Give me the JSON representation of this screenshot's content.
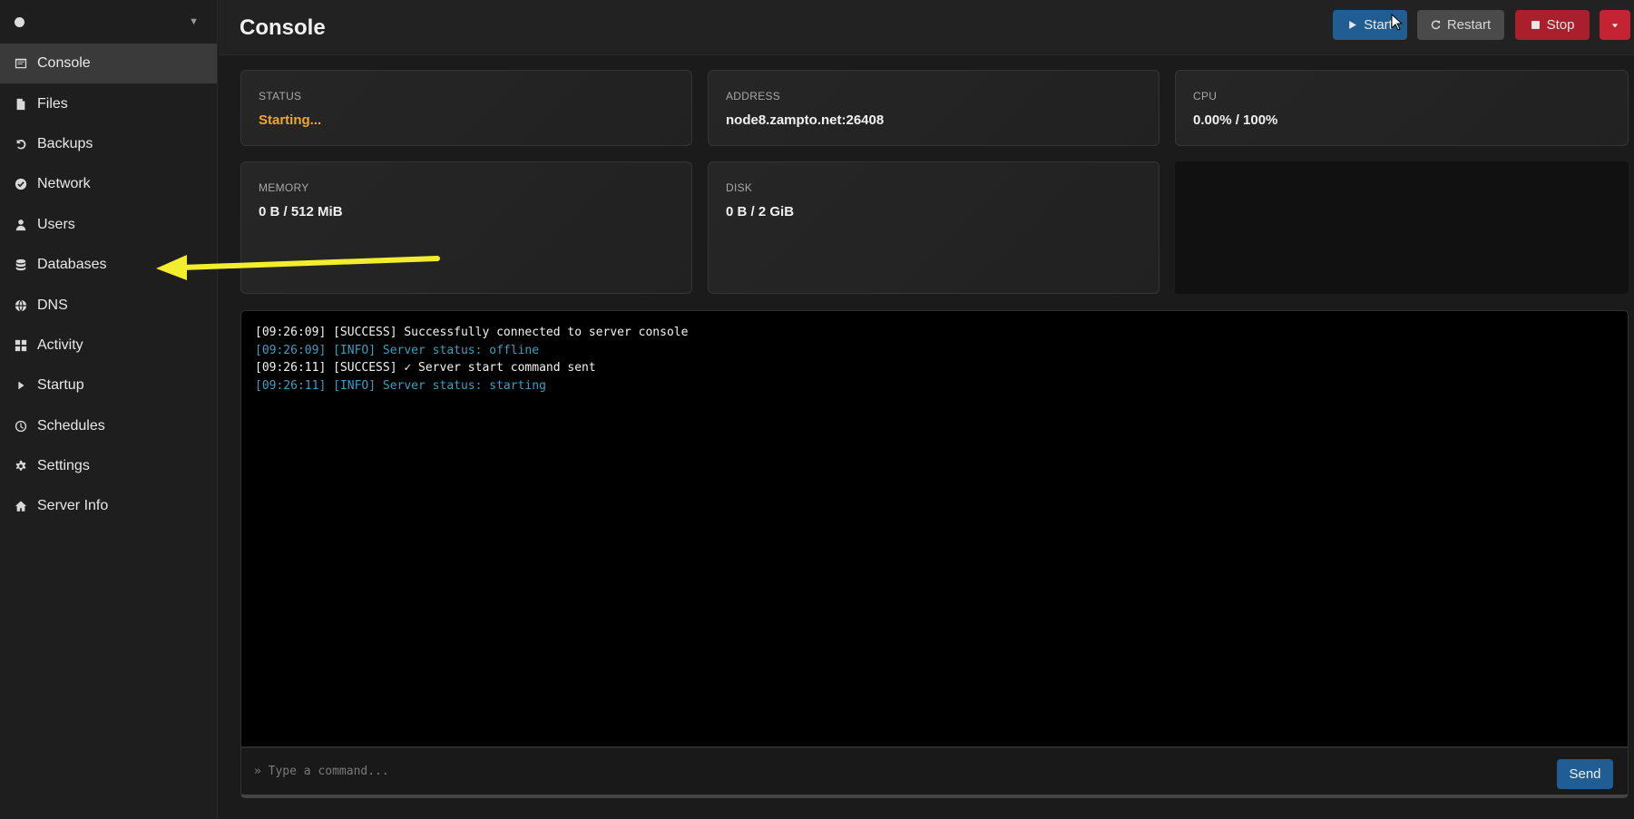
{
  "sidebar": {
    "items": [
      {
        "label": "Console",
        "icon": "console-icon"
      },
      {
        "label": "Files",
        "icon": "file-icon"
      },
      {
        "label": "Backups",
        "icon": "undo-icon"
      },
      {
        "label": "Network",
        "icon": "check-circle-icon"
      },
      {
        "label": "Users",
        "icon": "user-icon"
      },
      {
        "label": "Databases",
        "icon": "database-icon"
      },
      {
        "label": "DNS",
        "icon": "globe-icon"
      },
      {
        "label": "Activity",
        "icon": "grid-icon"
      },
      {
        "label": "Startup",
        "icon": "play-icon"
      },
      {
        "label": "Schedules",
        "icon": "clock-icon"
      },
      {
        "label": "Settings",
        "icon": "gear-icon"
      },
      {
        "label": "Server Info",
        "icon": "home-icon"
      }
    ]
  },
  "header": {
    "title": "Console",
    "start_label": "Start",
    "restart_label": "Restart",
    "stop_label": "Stop"
  },
  "stats": {
    "status": {
      "label": "STATUS",
      "value": "Starting..."
    },
    "address": {
      "label": "ADDRESS",
      "value": "node8.zampto.net:26408"
    },
    "cpu": {
      "label": "CPU",
      "value": "0.00% / 100%"
    },
    "memory": {
      "label": "MEMORY",
      "value": "0 B / 512 MiB"
    },
    "disk": {
      "label": "DISK",
      "value": "0 B / 2 GiB"
    }
  },
  "console": {
    "lines": [
      {
        "text": "[09:26:09] [SUCCESS] Successfully connected to server console",
        "level": "success"
      },
      {
        "text": "[09:26:09] [INFO] Server status: offline",
        "level": "info"
      },
      {
        "text": "[09:26:11] [SUCCESS] ✓ Server start command sent",
        "level": "success"
      },
      {
        "text": "[09:26:11] [INFO] Server status: starting",
        "level": "info"
      }
    ],
    "input_placeholder": "» Type a command...",
    "send_label": "Send"
  },
  "colors": {
    "status_starting": "#f0a72a",
    "info_text": "#3a9fc2",
    "primary": "#1f5d93",
    "danger": "#a91f2b",
    "annotation_arrow": "#f2ee2e"
  }
}
